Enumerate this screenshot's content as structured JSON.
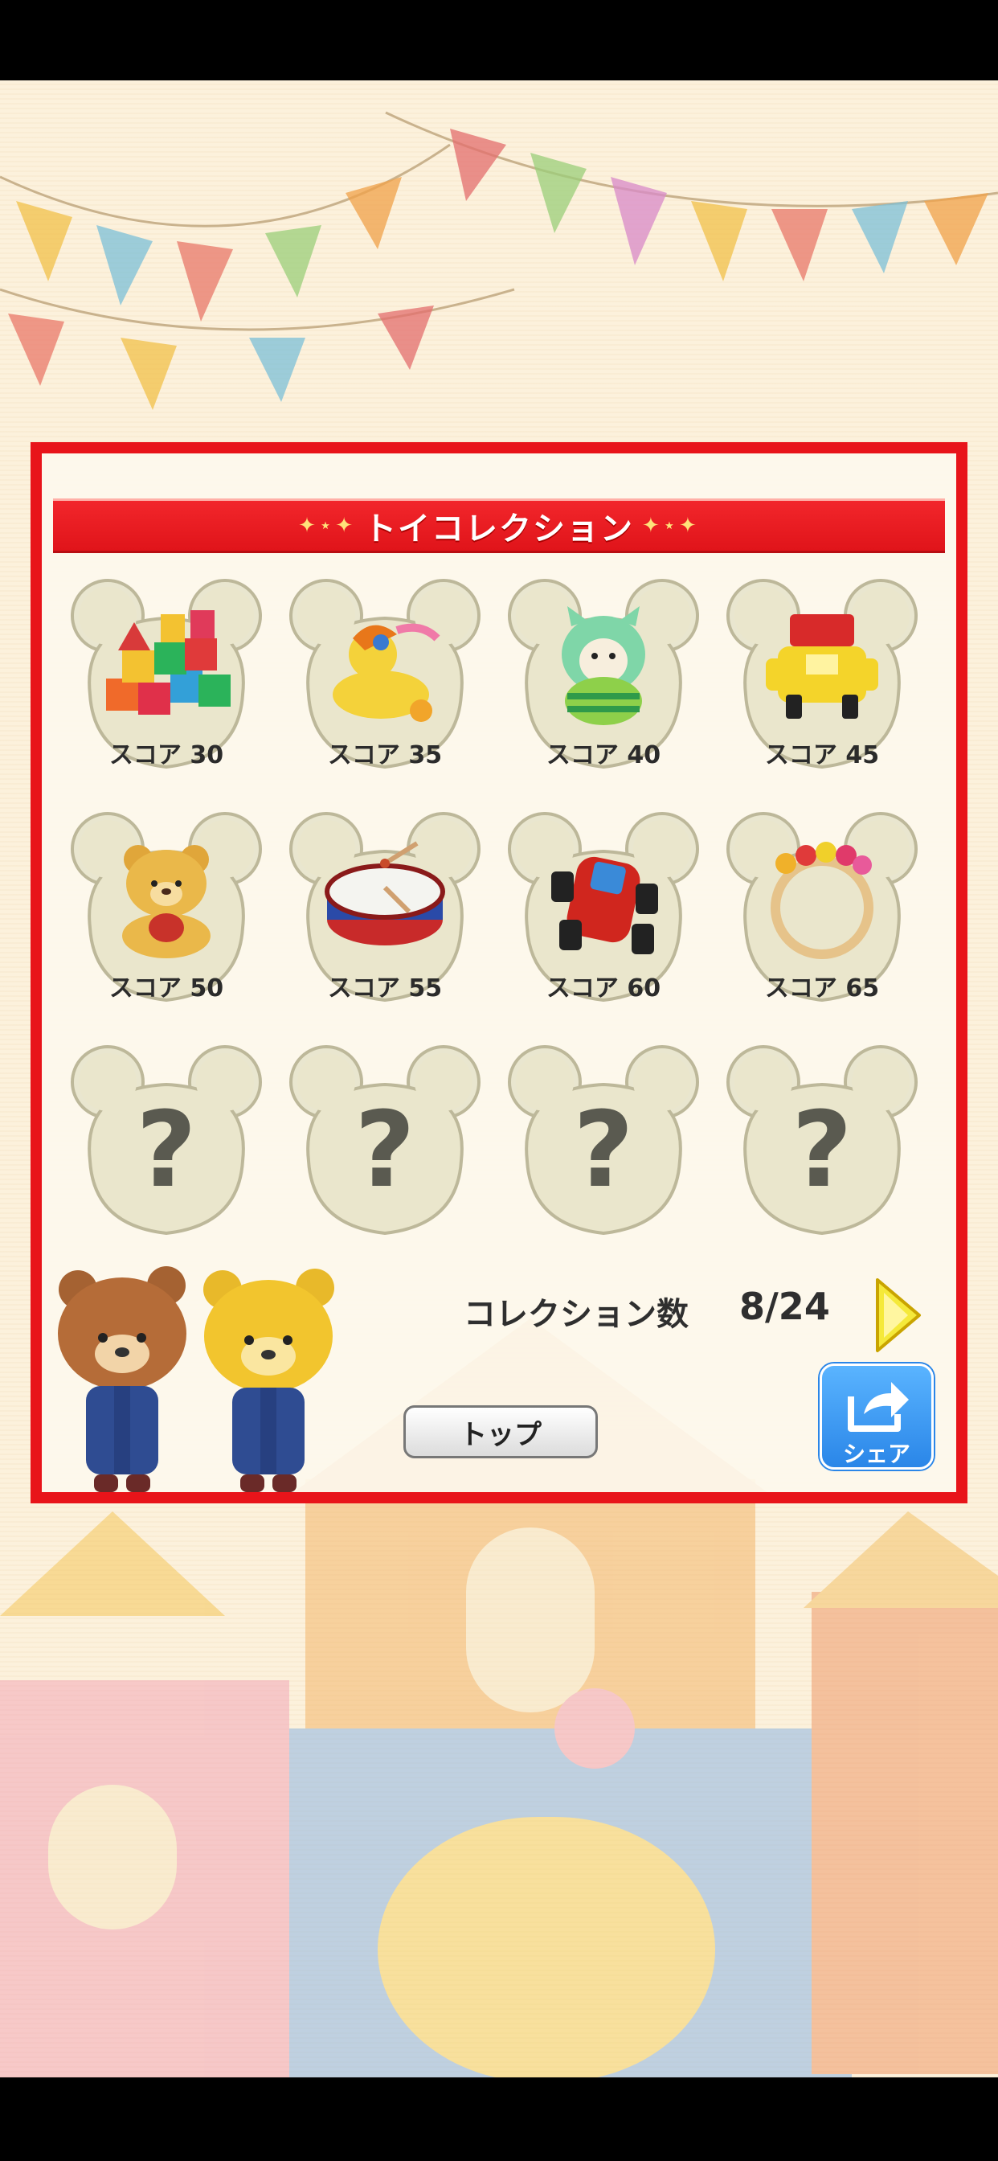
{
  "panel": {
    "title": "トイコレクション",
    "title_sparkles_left": "✦⋆✦",
    "title_sparkles_right": "✦⋆✦"
  },
  "slots": [
    {
      "label": "スコア 30",
      "icon": "building-blocks-icon",
      "unlocked": true
    },
    {
      "label": "スコア 35",
      "icon": "duck-toy-icon",
      "unlocked": true
    },
    {
      "label": "スコア 40",
      "icon": "green-creature-doll-icon",
      "unlocked": true
    },
    {
      "label": "スコア 45",
      "icon": "yellow-toy-car-icon",
      "unlocked": true
    },
    {
      "label": "スコア 50",
      "icon": "teddy-bear-icon",
      "unlocked": true
    },
    {
      "label": "スコア 55",
      "icon": "toy-drum-icon",
      "unlocked": true
    },
    {
      "label": "スコア 60",
      "icon": "red-toy-car-icon",
      "unlocked": true
    },
    {
      "label": "スコア 65",
      "icon": "baby-rattle-ring-icon",
      "unlocked": true
    },
    {
      "label": "?",
      "icon": "unknown-toy-icon",
      "unlocked": false
    },
    {
      "label": "?",
      "icon": "unknown-toy-icon",
      "unlocked": false
    },
    {
      "label": "?",
      "icon": "unknown-toy-icon",
      "unlocked": false
    },
    {
      "label": "?",
      "icon": "unknown-toy-icon",
      "unlocked": false
    }
  ],
  "collection": {
    "label": "コレクション数",
    "value": "8/24"
  },
  "buttons": {
    "top": "トップ",
    "share": "シェア",
    "next_icon": "play-triangle-icon"
  },
  "colors": {
    "frame_red": "#e8141a",
    "share_blue": "#2a86e8",
    "next_yellow": "#f5e93a"
  }
}
